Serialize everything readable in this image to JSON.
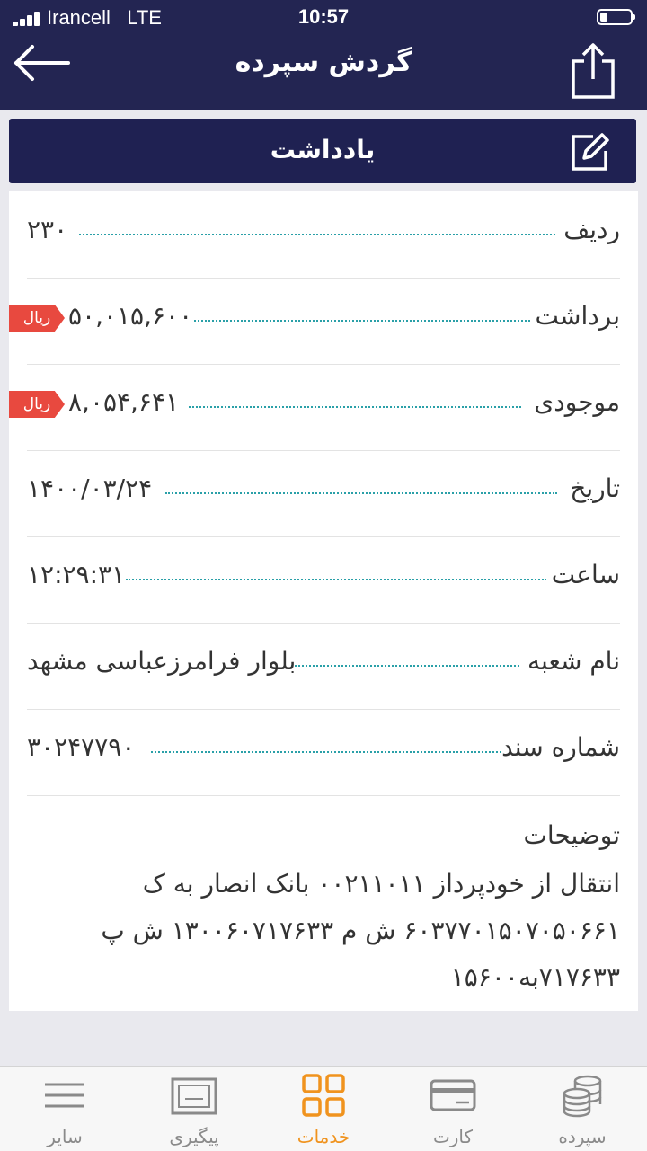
{
  "status_bar": {
    "carrier": "Irancell   LTE",
    "time": "10:57"
  },
  "header": {
    "title": "گردش سپرده",
    "back_icon": "arrow-left-icon",
    "share_icon": "share-icon"
  },
  "note_bar": {
    "label": "یادداشت",
    "icon": "edit-icon"
  },
  "details": [
    {
      "label": "ردیف",
      "value": "۲۳۰",
      "unit": ""
    },
    {
      "label": "برداشت",
      "value": "۵۰,۰۱۵,۶۰۰",
      "unit": "ریال"
    },
    {
      "label": "موجودی",
      "value": "۸,۰۵۴,۶۴۱",
      "unit": "ریال"
    },
    {
      "label": "تاریخ",
      "value": "۱۴۰۰/۰۳/۲۴",
      "unit": ""
    },
    {
      "label": "ساعت",
      "value": "۱۲:۲۹:۳۱",
      "unit": ""
    },
    {
      "label": "نام شعبه",
      "value": "بلوار فرامرزعباسی مشهد",
      "unit": ""
    },
    {
      "label": "شماره سند",
      "value": "۳۰۲۴۷۷۹۰",
      "unit": ""
    }
  ],
  "description": {
    "title": "توضیحات",
    "text": "انتقال از خودپرداز ۰۰۲۱۱۰۱۱ بانک انصار به ک ۶۰۳۷۷۰۱۵۰۷۰۵۰۶۶۱ ش م ۱۳۰۰۶۰۷۱۷۶۳۳ ش پ ۷۱۷۶۳۳به۱۵۶۰۰"
  },
  "tabs": [
    {
      "label": "سایر",
      "icon": "menu-icon",
      "active": false
    },
    {
      "label": "پیگیری",
      "icon": "tracking-icon",
      "active": false
    },
    {
      "label": "خدمات",
      "icon": "services-grid-icon",
      "active": true
    },
    {
      "label": "کارت",
      "icon": "card-icon",
      "active": false
    },
    {
      "label": "سپرده",
      "icon": "coins-icon",
      "active": false
    }
  ],
  "colors": {
    "header_bg": "#232552",
    "accent_active_tab": "#f0931e",
    "currency_tag": "#e8493f",
    "dotted_leader": "#2aa0a8"
  }
}
